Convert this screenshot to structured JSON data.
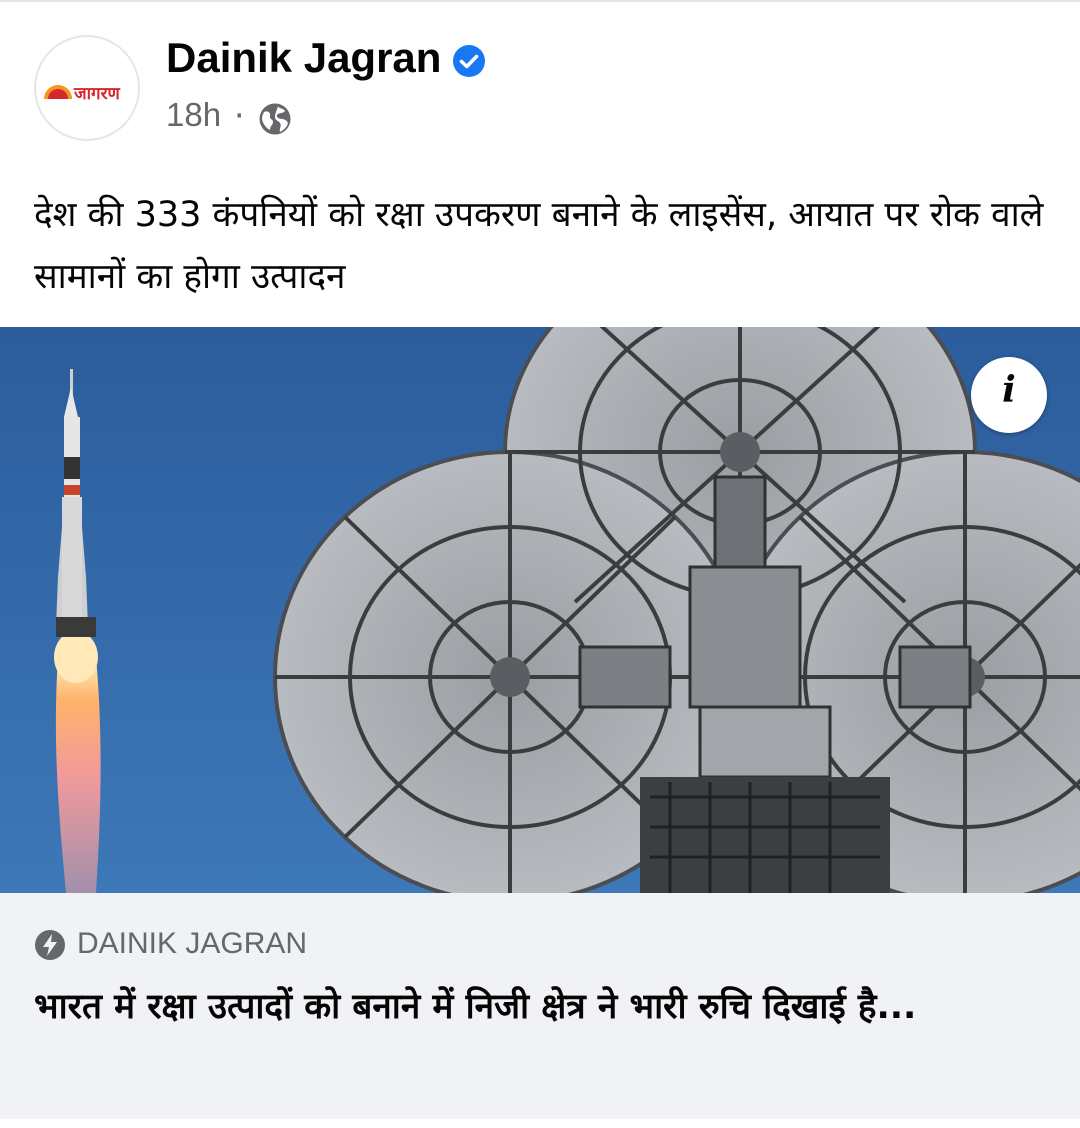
{
  "post": {
    "page_name": "Dainik Jagran",
    "verified": true,
    "timestamp": "18h",
    "separator": "·",
    "audience_icon": "globe-icon",
    "avatar_logo_text": "जागरण",
    "caption": "देश की 333 कंपनियों को रक्षा उपकरण बनाने के लाइसेंस, आयात पर रोक वाले सामानों का होगा उत्पादन"
  },
  "media": {
    "info_icon_label": "i"
  },
  "link_preview": {
    "domain_icon": "bolt-icon",
    "domain": "DAINIK JAGRAN",
    "title": "भारत में रक्षा उत्पादों को बनाने में निजी क्षेत्र ने भारी रुचि दिखाई है..."
  },
  "colors": {
    "verified_blue": "#1877f2",
    "secondary_text": "#65676b",
    "primary_text": "#050505",
    "link_bg": "#f0f2f5",
    "brand_red": "#d7262c"
  }
}
